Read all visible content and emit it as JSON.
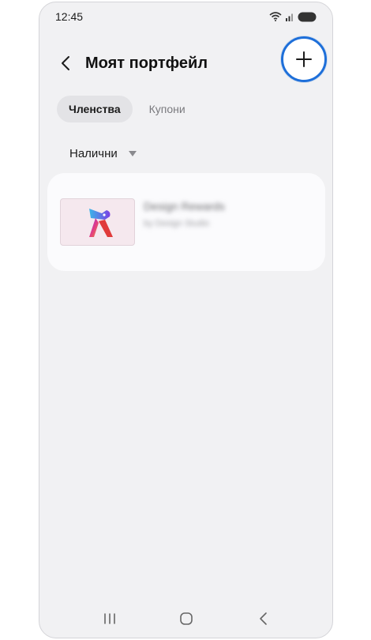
{
  "status_bar": {
    "time": "12:45",
    "icons": [
      "wifi-icon",
      "signal-icon",
      "battery-icon"
    ]
  },
  "header": {
    "title": "Моят портфейл",
    "back_icon": "chevron-left-icon",
    "add_icon": "plus-icon"
  },
  "tabs": [
    {
      "label": "Членства",
      "active": true
    },
    {
      "label": "Купони",
      "active": false
    }
  ],
  "filter": {
    "selected": "Налични",
    "icon": "triangle-down-icon"
  },
  "cards": [
    {
      "title": "Design Rewards",
      "subtitle": "by Design Studio",
      "image_icon": "rabbit-logo-icon"
    }
  ],
  "nav_bar": {
    "items": [
      "recent-apps-icon",
      "home-icon",
      "back-icon"
    ]
  },
  "colors": {
    "highlight": "#1e6fd9",
    "background": "#f1f1f3",
    "card": "#fbfbfd"
  }
}
